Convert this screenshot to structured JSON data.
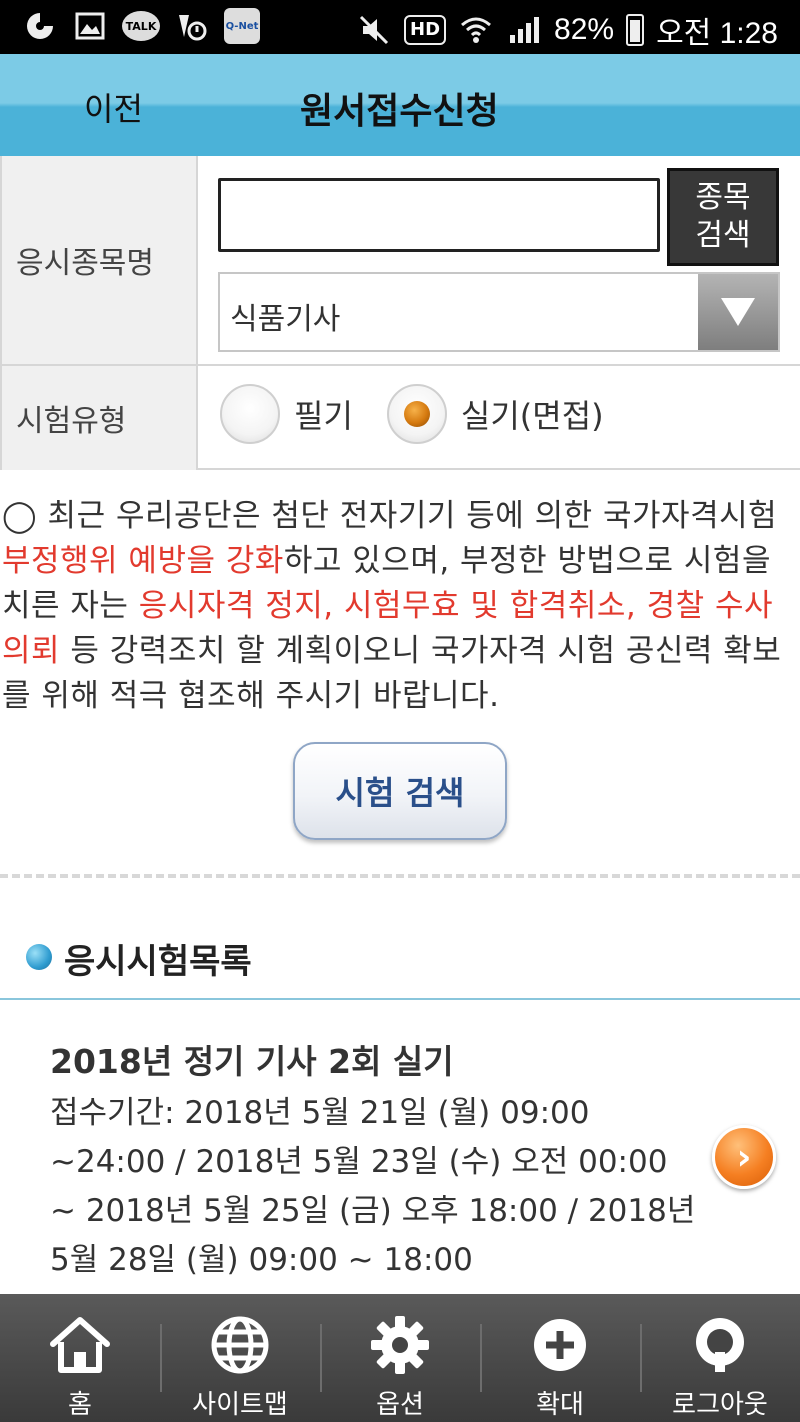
{
  "status_bar": {
    "talk_badge": "TALK",
    "qnet_badge": "Q-Net",
    "hd_badge": "HD",
    "battery": "82%",
    "time": "오전 1:28"
  },
  "header": {
    "back_label": "이전",
    "title": "원서접수신청"
  },
  "form": {
    "subject_label": "응시종목명",
    "search_input_value": "",
    "search_button_label": "종목\n검색",
    "selected_subject": "식품기사",
    "exam_type_label": "시험유형",
    "radio_options": [
      {
        "label": "필기",
        "selected": false
      },
      {
        "label": "실기(면접)",
        "selected": true
      }
    ]
  },
  "notice": {
    "p1": "◯ 최근 우리공단은 첨단 전자기기 등에 의한 국가자격시험 ",
    "p2": "부정행위 예방을 강화",
    "p3": "하고 있으며, 부정한 방법으로 시험을 치른 자는 ",
    "p4": "응시자격 정지, 시험무효 및 합격취소, 경찰 수사의뢰",
    "p5": " 등 강력조치 할 계획이오니 국가자격 시험 공신력 확보를 위해 적극 협조해 주시기 바랍니다."
  },
  "exam_search_button": "시험 검색",
  "section_title": "응시시험목록",
  "exam_item": {
    "title": "2018년 정기 기사 2회 실기",
    "description": "접수기간: 2018년 5월 21일 (월) 09:00 ~24:00 / 2018년 5월 23일 (수) 오전 00:00 ~ 2018년 5월 25일 (금) 오후 18:00 / 2018년 5월 28일 (월) 09:00 ~ 18:00",
    "arrow": "›"
  },
  "bottom_nav": [
    {
      "label": "홈",
      "icon": "home-icon"
    },
    {
      "label": "사이트맵",
      "icon": "globe-icon"
    },
    {
      "label": "옵션",
      "icon": "gear-icon"
    },
    {
      "label": "확대",
      "icon": "plus-circle-icon"
    },
    {
      "label": "로그아웃",
      "icon": "logout-icon"
    }
  ],
  "colors": {
    "header_top": "#7ccbe6",
    "header_bottom": "#4bb2d8",
    "notice_red": "#e23a2e",
    "button_text": "#2a4f8a",
    "nav_bg": "#3a3a3a",
    "arrow_orange": "#f57f22"
  }
}
